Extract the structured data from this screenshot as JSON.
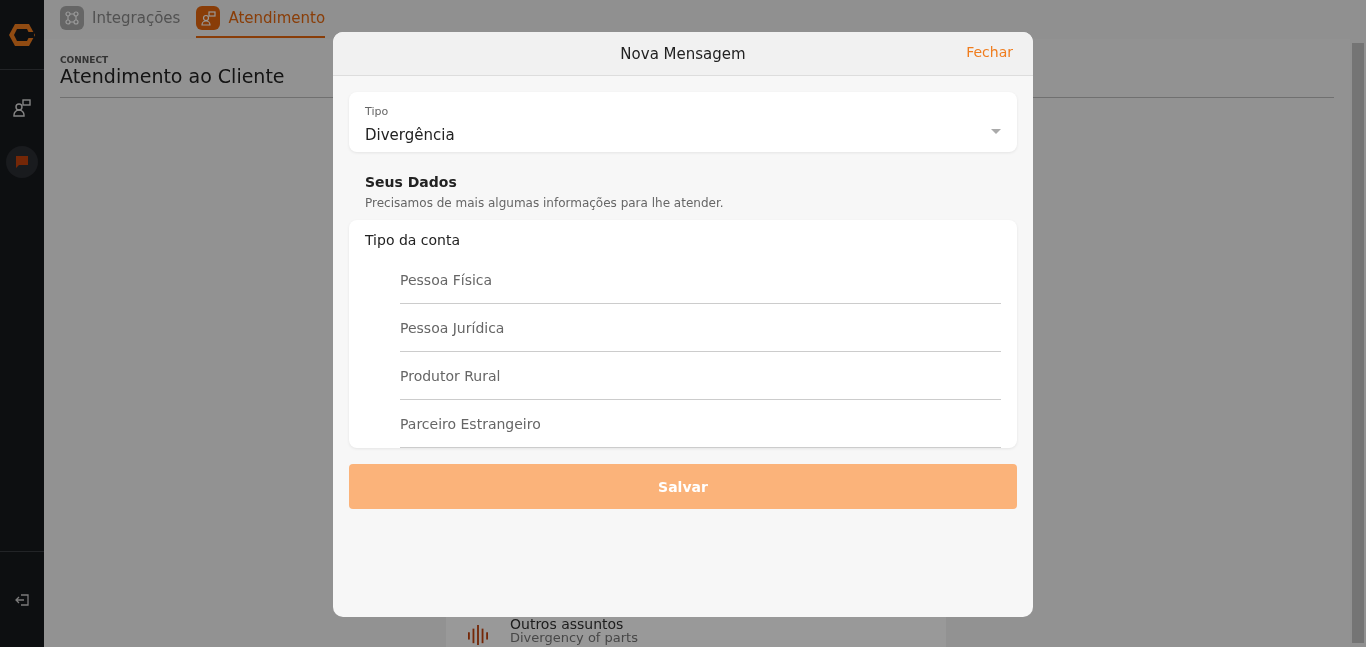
{
  "top_tabs": [
    {
      "label": "Integrações",
      "selected": false
    },
    {
      "label": "Atendimento",
      "selected": true
    }
  ],
  "page": {
    "section": "CONNECT",
    "title": "Atendimento ao Cliente"
  },
  "background_card": {
    "title": "Outros assuntos",
    "subtitle": "Divergency of parts"
  },
  "modal": {
    "title": "Nova Mensagem",
    "close": "Fechar",
    "type_field": {
      "label": "Tipo",
      "value": "Divergência"
    },
    "section_title": "Seus Dados",
    "section_subtitle": "Precisamos de mais algumas informações para lhe atender.",
    "account_type": {
      "label": "Tipo da conta",
      "options": [
        {
          "label": "Pessoa Física",
          "selected": false
        },
        {
          "label": "Pessoa Jurídica",
          "selected": false
        },
        {
          "label": "Produtor Rural",
          "selected": false
        },
        {
          "label": "Parceiro Estrangeiro",
          "selected": false
        }
      ]
    },
    "save_button": {
      "label": "Salvar",
      "disabled": true
    }
  }
}
